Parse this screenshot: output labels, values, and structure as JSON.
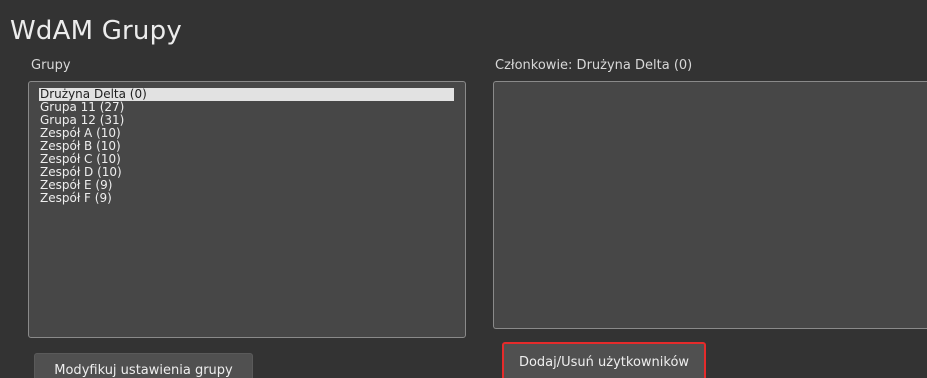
{
  "window": {
    "title": "WdAM Grupy"
  },
  "groups_panel": {
    "label": "Grupy",
    "items": [
      {
        "label": "Drużyna Delta (0)",
        "selected": true
      },
      {
        "label": "Grupa 11 (27)",
        "selected": false
      },
      {
        "label": "Grupa 12 (31)",
        "selected": false
      },
      {
        "label": "Zespół A (10)",
        "selected": false
      },
      {
        "label": "Zespół B (10)",
        "selected": false
      },
      {
        "label": "Zespół C (10)",
        "selected": false
      },
      {
        "label": "Zespół D (10)",
        "selected": false
      },
      {
        "label": "Zespół E (9)",
        "selected": false
      },
      {
        "label": "Zespół F (9)",
        "selected": false
      }
    ],
    "modify_button_label": "Modyfikuj ustawienia grupy"
  },
  "members_panel": {
    "label": "Członkowie: Drużyna Delta (0)",
    "items": [],
    "add_remove_button_label": "Dodaj/Usuń użytkowników"
  },
  "colors": {
    "background": "#333333",
    "list_background": "#474747",
    "selection": "#e2e2e2",
    "highlight_border": "#e52b2b"
  }
}
